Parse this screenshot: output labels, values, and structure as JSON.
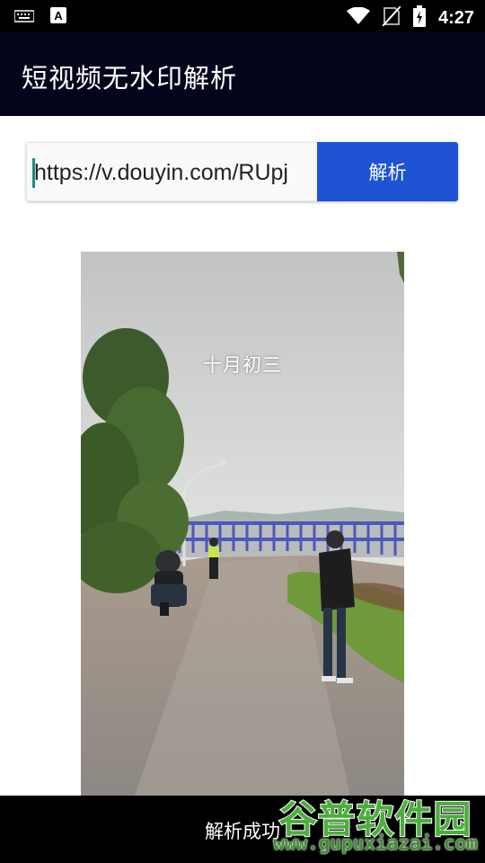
{
  "status_bar": {
    "time": "4:27",
    "left_icons": [
      "keyboard-icon",
      "a-notification-icon"
    ],
    "right_icons": [
      "wifi-icon",
      "no-sim-icon",
      "battery-icon"
    ]
  },
  "app_bar": {
    "title": "短视频无水印解析",
    "background": "#04041c"
  },
  "form": {
    "url_value": "https://v.douyin.com/RUpj",
    "parse_label": "解析",
    "accent": "#1e53d6"
  },
  "video": {
    "caption": "十月初三"
  },
  "toast": {
    "text": "解析成功"
  },
  "watermark": {
    "title": "谷普软件园",
    "url": "www.gupuxiazai.com",
    "color": "#4cae3c"
  }
}
